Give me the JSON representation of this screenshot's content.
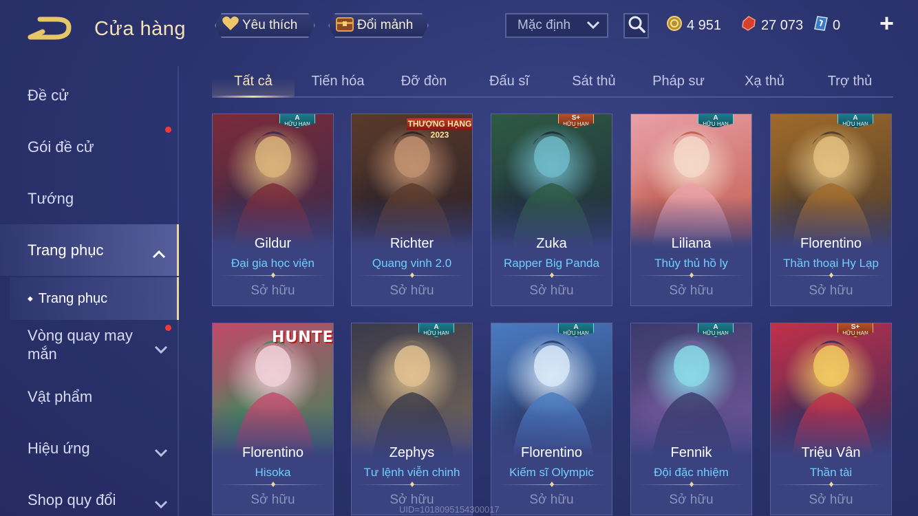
{
  "header": {
    "title": "Cửa hàng",
    "favorites_label": "Yêu thích",
    "shards_label": "Đổi mảnh",
    "sort_value": "Mặc định",
    "currencies": [
      {
        "name": "gold-coin",
        "value": "4 951",
        "color": "#d9b24a"
      },
      {
        "name": "voucher",
        "value": "27 073",
        "color": "#e0523f"
      },
      {
        "name": "ticket",
        "value": "0",
        "color": "#6fb8ff"
      }
    ]
  },
  "sidebar": {
    "items": [
      {
        "label": "Đề cử"
      },
      {
        "label": "Gói đề cử",
        "dot": true
      },
      {
        "label": "Tướng"
      },
      {
        "label": "Trang phục",
        "expanded": true
      },
      {
        "label": "Vòng quay may mắn",
        "dot": true
      },
      {
        "label": "Vật phẩm"
      },
      {
        "label": "Hiệu ứng"
      },
      {
        "label": "Shop quy đổi"
      }
    ],
    "subitem": "Trang phục"
  },
  "tabs": [
    "Tất cả",
    "Tiến hóa",
    "Đỡ đòn",
    "Đấu sĩ",
    "Sát thủ",
    "Pháp sư",
    "Xạ thủ",
    "Trợ thủ"
  ],
  "active_tab": "Tất cả",
  "cards": [
    {
      "hero": "Gildur",
      "skin": "Đại gia học viện",
      "status": "Sở hữu",
      "badge_tier": "A",
      "badge_text": "HỮU HẠN",
      "palette": [
        "#7a2b3a",
        "#d8b27a",
        "#3a2a4a"
      ]
    },
    {
      "hero": "Richter",
      "skin": "Quang vinh 2.0",
      "status": "Sở hữu",
      "banner": "THƯỢNG HẠNG",
      "banner_year": "2023",
      "palette": [
        "#5a3a2a",
        "#c09070",
        "#2a2028"
      ]
    },
    {
      "hero": "Zuka",
      "skin": "Rapper Big Panda",
      "status": "Sở hữu",
      "badge_tier": "S+",
      "badge_text": "HỮU HẠN",
      "palette": [
        "#2d5a44",
        "#6fb8c8",
        "#1f2a3a"
      ]
    },
    {
      "hero": "Liliana",
      "skin": "Thủy thủ hồ ly",
      "status": "Sở hữu",
      "badge_tier": "A",
      "badge_text": "HỮU HẠN",
      "palette": [
        "#e8a0a8",
        "#f4d8c8",
        "#c05a4a"
      ]
    },
    {
      "hero": "Florentino",
      "skin": "Thần thoại Hy Lạp",
      "status": "Sở hữu",
      "badge_tier": "A",
      "badge_text": "HỮU HẠN",
      "palette": [
        "#a06a2a",
        "#e0c080",
        "#4a3a2a"
      ]
    },
    {
      "hero": "Florentino",
      "skin": "Hisoka",
      "status": "Sở hữu",
      "logo": "HUNTER",
      "palette": [
        "#c04a6a",
        "#f0d0d8",
        "#3a8a5a"
      ]
    },
    {
      "hero": "Zephys",
      "skin": "Tư lệnh viễn chinh",
      "status": "Sở hữu",
      "badge_tier": "A",
      "badge_text": "HỮU HẠN",
      "palette": [
        "#3a3a4a",
        "#e0c090",
        "#7a6a5a"
      ]
    },
    {
      "hero": "Florentino",
      "skin": "Kiếm sĩ Olympic",
      "status": "Sở hữu",
      "badge_tier": "A",
      "badge_text": "HỮU HẠN",
      "palette": [
        "#4a7ac0",
        "#d8e8f8",
        "#2a3a6a"
      ]
    },
    {
      "hero": "Fennik",
      "skin": "Đội đặc nhiệm",
      "status": "Sở hữu",
      "badge_tier": "A",
      "badge_text": "HỮU HẠN",
      "palette": [
        "#3a3a6a",
        "#8ad8e8",
        "#7a5aa0"
      ]
    },
    {
      "hero": "Triệu Vân",
      "skin": "Thần tài",
      "status": "Sở hữu",
      "badge_tier": "S+",
      "badge_text": "HỮU HẠN",
      "palette": [
        "#c0304a",
        "#f0c860",
        "#3a2a5a"
      ]
    }
  ],
  "watermark": "UID=1018095154300017",
  "colors": {
    "accent_gold": "#f3e4b7",
    "skin_name": "#6fd0ff",
    "notify_dot": "#f03a3a"
  }
}
